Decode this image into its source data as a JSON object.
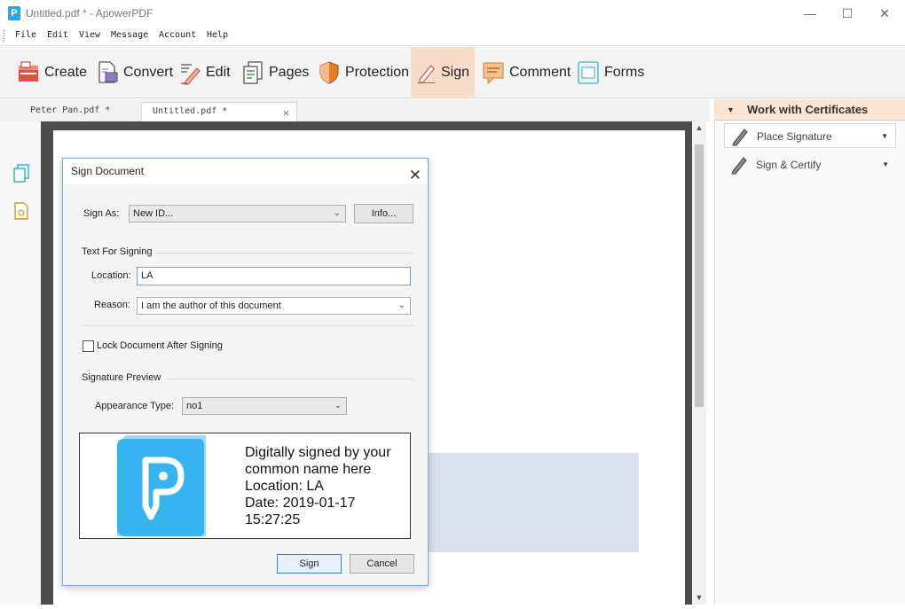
{
  "window": {
    "title": "Untitled.pdf * - ApowerPDF",
    "app_icon_letter": "P",
    "minimize": "—",
    "maximize": "☐",
    "close": "✕"
  },
  "menu": [
    "File",
    "Edit",
    "View",
    "Message",
    "Account",
    "Help"
  ],
  "toolbar": [
    {
      "label": "Create"
    },
    {
      "label": "Convert"
    },
    {
      "label": "Edit"
    },
    {
      "label": "Pages"
    },
    {
      "label": "Protection"
    },
    {
      "label": "Sign"
    },
    {
      "label": "Comment"
    },
    {
      "label": "Forms"
    }
  ],
  "toolbar_active": "Sign",
  "tabs": [
    {
      "label": "Peter Pan.pdf *"
    },
    {
      "label": "Untitled.pdf *"
    }
  ],
  "tab_close": "✕",
  "right_panel": {
    "header": "Work with Certificates",
    "items": [
      {
        "label": "Place Signature"
      },
      {
        "label": "Sign & Certify"
      }
    ]
  },
  "dialog": {
    "title": "Sign Document",
    "sign_as_label": "Sign As:",
    "sign_as_value": "New ID...",
    "info_button": "Info...",
    "text_group": "Text For Signing",
    "location_label": "Location:",
    "location_value": "LA",
    "reason_label": "Reason:",
    "reason_value": "I am the author of this document",
    "lock_label": "Lock Document After Signing",
    "lock_checked": false,
    "preview_group": "Signature Preview",
    "appearance_label": "Appearance Type:",
    "appearance_value": "no1",
    "preview_lines": [
      "Digitally signed by your common name here",
      "Location: LA",
      "Date: 2019-01-17 15:27:25"
    ],
    "sign_button": "Sign",
    "cancel_button": "Cancel"
  },
  "colors": {
    "toolbar_active": "#f9dcc7",
    "panel_header": "#fbe5d2",
    "brand_blue": "#2aa7e6",
    "signature_field": "#d9dfee"
  }
}
